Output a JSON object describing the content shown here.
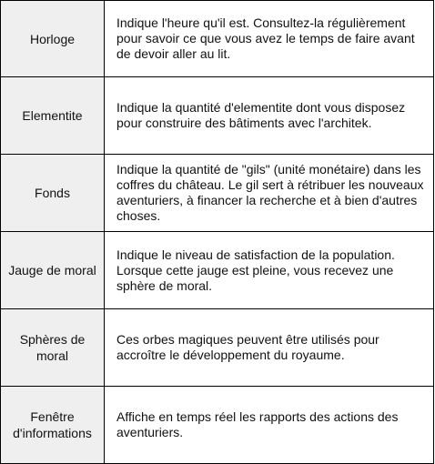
{
  "rows": [
    {
      "term": "Horloge",
      "description": "Indique l'heure qu'il est. Consultez-la régulièrement pour savoir ce que vous avez le temps de faire avant de devoir aller au lit."
    },
    {
      "term": "Elementite",
      "description": "Indique la quantité d'elementite dont vous disposez pour construire des bâtiments avec l'architek."
    },
    {
      "term": "Fonds",
      "description": "Indique la quantité de \"gils\" (unité monétaire) dans les coffres du château. Le gil sert à rétribuer les nouveaux aventuriers, à financer la recherche et à bien d'autres choses."
    },
    {
      "term": "Jauge de moral",
      "description": "Indique le niveau de satisfaction de la population. Lorsque cette jauge est pleine, vous recevez une sphère de moral."
    },
    {
      "term": "Sphères de moral",
      "description": "Ces orbes magiques peuvent être utilisés pour accroître le développement du royaume."
    },
    {
      "term": "Fenêtre d'informations",
      "description": "Affiche en temps réel les rapports des actions des aventuriers."
    }
  ]
}
